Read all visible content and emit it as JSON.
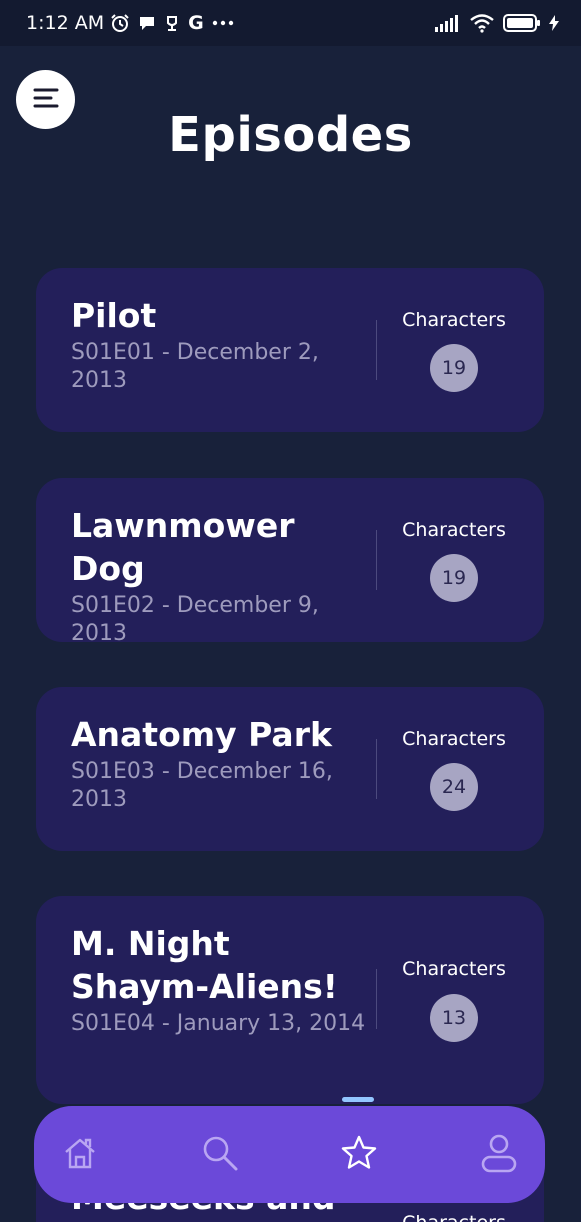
{
  "status_bar": {
    "time": "1:12 AM",
    "left_icons": [
      "alarm-icon",
      "chat-bubble-icon",
      "app-notification-icon",
      "google-icon",
      "more-dots-icon"
    ],
    "right_icons": [
      "signal-icon",
      "wifi-icon",
      "battery-icon",
      "charging-icon"
    ]
  },
  "header": {
    "title": "Episodes",
    "menu_icon": "menu-icon"
  },
  "episodes": [
    {
      "title": "Pilot",
      "code_date": "S01E01 - December 2, 2013",
      "characters_label": "Characters",
      "characters_count": "19"
    },
    {
      "title": "Lawnmower Dog",
      "code_date": "S01E02 - December 9, 2013",
      "characters_label": "Characters",
      "characters_count": "19"
    },
    {
      "title": "Anatomy Park",
      "code_date": "S01E03 - December 16, 2013",
      "characters_label": "Characters",
      "characters_count": "24"
    },
    {
      "title": "M. Night Shaym-Aliens!",
      "code_date": "S01E04 - January 13, 2014",
      "characters_label": "Characters",
      "characters_count": "13"
    },
    {
      "title": "Meeseeks and",
      "code_date": "",
      "characters_label": "Characters",
      "characters_count": ""
    }
  ],
  "bottom_nav": {
    "items": [
      {
        "name": "home",
        "icon": "home-icon",
        "active": false
      },
      {
        "name": "search",
        "icon": "search-icon",
        "active": false
      },
      {
        "name": "episodes",
        "icon": "star-icon",
        "active": true
      },
      {
        "name": "profile",
        "icon": "user-icon",
        "active": false
      }
    ]
  },
  "colors": {
    "background": "#18213a",
    "card": "#231f5a",
    "nav": "#6b49d9",
    "active_indicator": "#93c6ff",
    "count_badge": "#a7a5c3"
  }
}
